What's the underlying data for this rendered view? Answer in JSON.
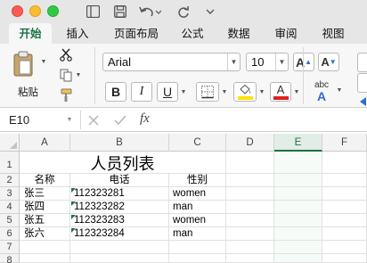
{
  "window": {
    "name_box": "E10"
  },
  "ribbon_tabs": [
    "开始",
    "插入",
    "页面布局",
    "公式",
    "数据",
    "审阅",
    "视图"
  ],
  "active_tab": "开始",
  "clipboard": {
    "paste_label": "粘贴"
  },
  "font": {
    "name": "Arial",
    "size": "10"
  },
  "format_buttons": {
    "bold": "B",
    "italic": "I",
    "underline": "U",
    "wrap": "abc"
  },
  "icons": {
    "sidebar": "sidebar-icon",
    "save": "save-icon",
    "undo": "undo-icon",
    "redo": "redo-icon",
    "more": "more-icon",
    "paste": "paste-icon",
    "cut": "scissors-icon",
    "copy": "copy-icon",
    "format_painter": "brush-icon",
    "grow": "grow-font-icon",
    "shrink": "shrink-font-icon",
    "borders": "borders-icon",
    "fill": "fill-color-icon",
    "font_color": "font-color-icon",
    "cancel": "cancel-icon",
    "enter": "check-icon",
    "function": "function-icon"
  },
  "formula_bar": {
    "fx": "fx",
    "content": ""
  },
  "colors": {
    "accent": "#1e7145",
    "fill_yellow": "#ffe200",
    "font_red": "#e0201c",
    "wrap_blue": "#2a6fd6"
  },
  "sheet": {
    "columns": [
      "A",
      "B",
      "C",
      "D",
      "E",
      "F"
    ],
    "selected_column": "E",
    "rows": [
      "1",
      "2",
      "3",
      "4",
      "5",
      "6",
      "7",
      "8"
    ],
    "title": "人员列表",
    "headers": [
      "名称",
      "电话",
      "性别"
    ],
    "data": [
      [
        "张三",
        "112323281",
        "women"
      ],
      [
        "张四",
        "112323282",
        "man"
      ],
      [
        "张五",
        "112323283",
        "women"
      ],
      [
        "张六",
        "112323284",
        "man"
      ]
    ]
  }
}
